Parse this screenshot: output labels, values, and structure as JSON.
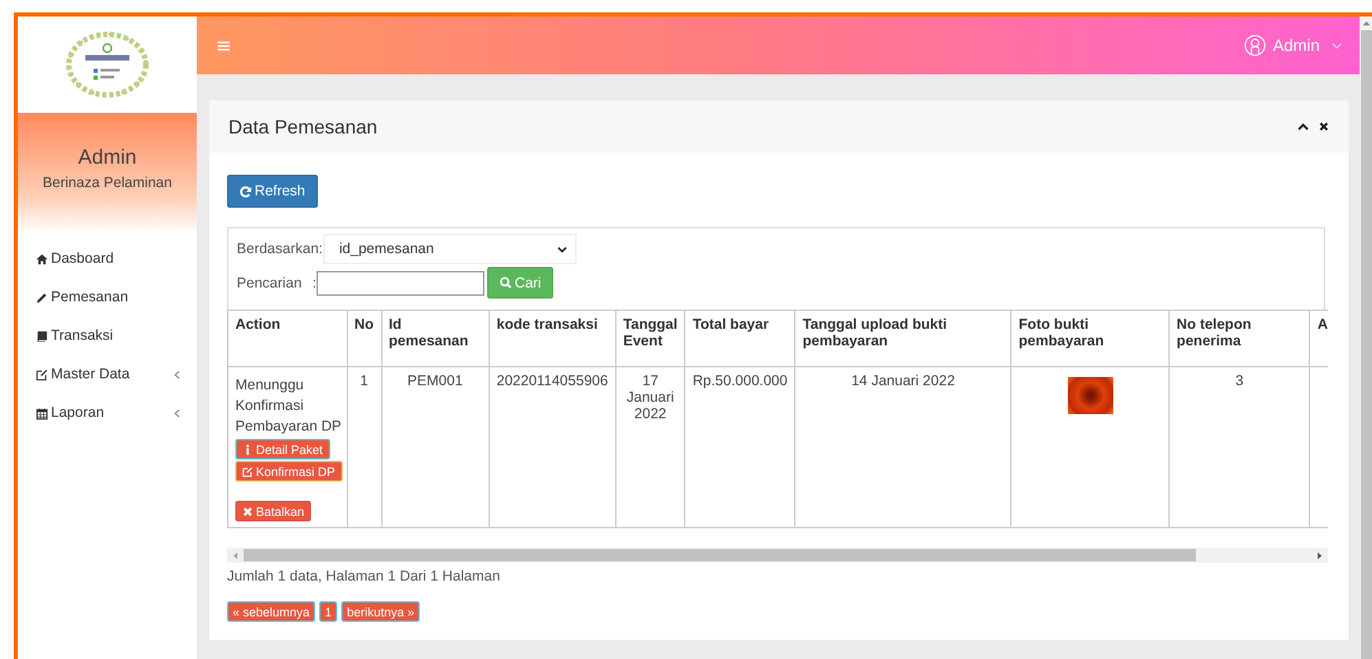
{
  "header": {
    "user": "Admin"
  },
  "sidebar": {
    "profile": {
      "name": "Admin",
      "subtitle": "Berinaza Pelaminan"
    },
    "items": [
      {
        "label": "Dasboard"
      },
      {
        "label": "Pemesanan"
      },
      {
        "label": "Transaksi"
      },
      {
        "label": "Master Data",
        "expanded": false
      },
      {
        "label": "Laporan",
        "expanded": false
      }
    ]
  },
  "panel": {
    "title": "Data Pemesanan",
    "refresh_button": "Refresh",
    "filter": {
      "by_label": "Berdasarkan:",
      "by_value": "id_pemesanan",
      "search_label": "Pencarian",
      "search_colon": ":",
      "search_button": "Cari"
    },
    "table": {
      "columns": [
        "Action",
        "No",
        "Id pemesanan",
        "kode transaksi",
        "Tanggal Event",
        "Total bayar",
        "Tanggal upload bukti pembayaran",
        "Foto bukti pembayaran",
        "No telepon penerima",
        "A"
      ],
      "rows": [
        {
          "status": "Menunggu Konfirmasi Pembayaran DP",
          "actions": [
            "Detail Paket",
            "Konfirmasi DP",
            "Batalkan"
          ],
          "no": "1",
          "id": "PEM001",
          "kode": "20220114055906",
          "tanggal_event": "17 Januari 2022",
          "total": "Rp.50.000.000",
          "tanggal_upload": "14 Januari 2022",
          "telepon": "3"
        }
      ]
    },
    "summary": "Jumlah 1 data, Halaman 1 Dari 1 Halaman",
    "pagination": [
      "« sebelumnya",
      "1",
      "berikutnya »"
    ]
  }
}
